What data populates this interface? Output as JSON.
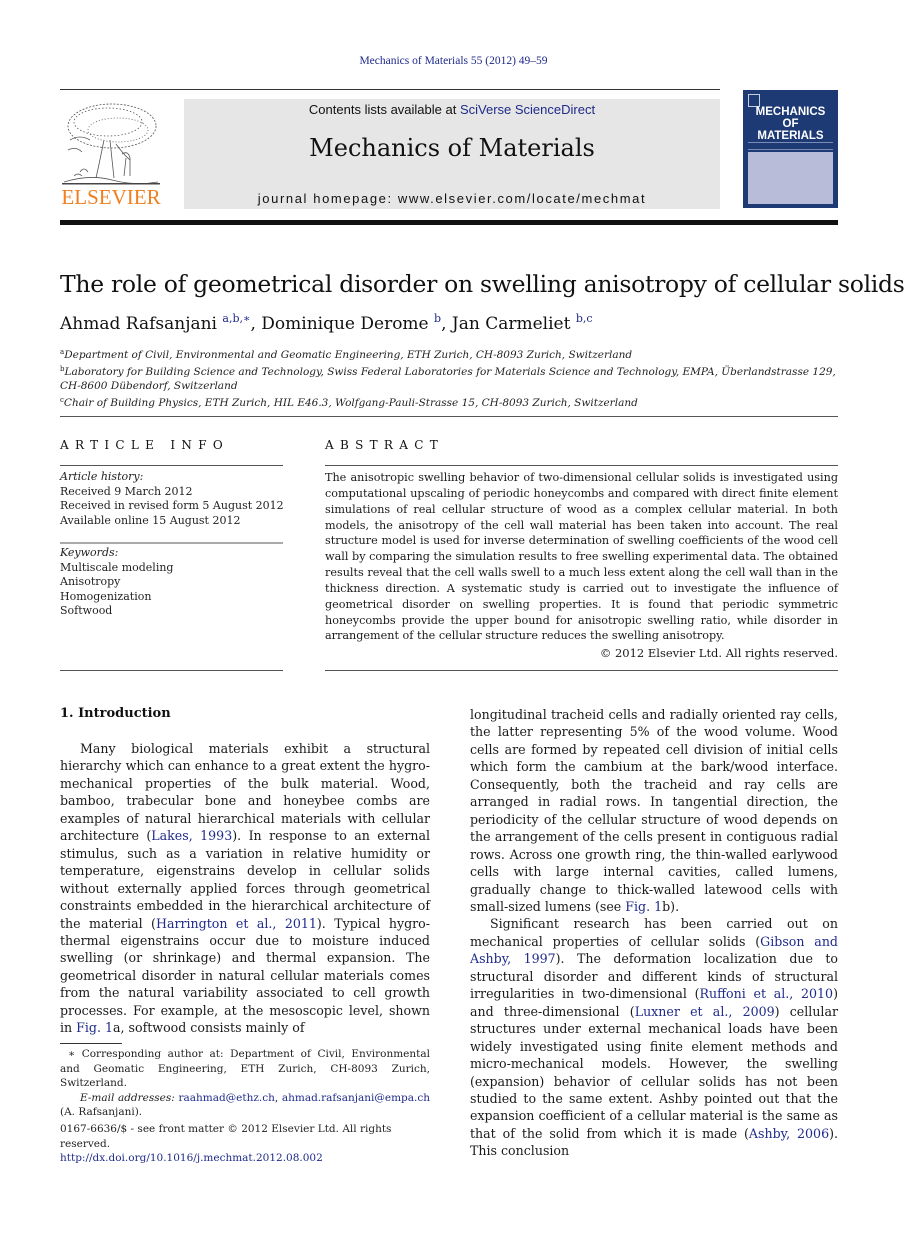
{
  "header": {
    "journal_reference": "Mechanics of Materials 55 (2012) 49–59",
    "publisher_logo_text": "ELSEVIER",
    "contents_prefix": "Contents lists available at ",
    "contents_link": "SciVerse ScienceDirect",
    "journal_title": "Mechanics of Materials",
    "homepage": "journal homepage: www.elsevier.com/locate/mechmat",
    "cover": {
      "title_line1": "MECHANICS",
      "title_line2": "OF",
      "title_line3": "MATERIALS",
      "color": "#1d3a75"
    }
  },
  "article": {
    "title": "The role of geometrical disorder on swelling anisotropy of cellular solids",
    "authors": [
      {
        "name": "Ahmad Rafsanjani",
        "sup": "a,b,∗",
        "sep": ", "
      },
      {
        "name": "Dominique Derome",
        "sup": "b",
        "sep": ", "
      },
      {
        "name": "Jan Carmeliet",
        "sup": "b,c",
        "sep": ""
      }
    ],
    "affiliations": [
      {
        "mark": "a",
        "text": "Department of Civil, Environmental and Geomatic Engineering, ETH Zurich, CH-8093 Zurich, Switzerland"
      },
      {
        "mark": "b",
        "text": "Laboratory for Building Science and Technology, Swiss Federal Laboratories for Materials Science and Technology, EMPA, Überlandstrasse 129, CH-8600 Dübendorf, Switzerland"
      },
      {
        "mark": "c",
        "text": "Chair of Building Physics, ETH Zurich, HIL E46.3, Wolfgang-Pauli-Strasse 15, CH-8093 Zurich, Switzerland"
      }
    ]
  },
  "article_info": {
    "heading": "ARTICLE INFO",
    "history_label": "Article history:",
    "history": [
      "Received 9 March 2012",
      "Received in revised form 5 August 2012",
      "Available online 15 August 2012"
    ],
    "keywords_label": "Keywords:",
    "keywords": [
      "Multiscale modeling",
      "Anisotropy",
      "Homogenization",
      "Softwood"
    ]
  },
  "abstract": {
    "heading": "ABSTRACT",
    "text": "The anisotropic swelling behavior of two-dimensional cellular solids is investigated using computational upscaling of periodic honeycombs and compared with direct finite element simulations of real cellular structure of wood as a complex cellular material. In both models, the anisotropy of the cell wall material has been taken into account. The real structure model is used for inverse determination of swelling coefficients of the wood cell wall by comparing the simulation results to free swelling experimental data. The obtained results reveal that the cell walls swell to a much less extent along the cell wall than in the thickness direction. A systematic study is carried out to investigate the influence of geometrical disorder on swelling properties. It is found that periodic symmetric honeycombs provide the upper bound for anisotropic swelling ratio, while disorder in arrangement of the cellular structure reduces the swelling anisotropy.",
    "copyright": "© 2012 Elsevier Ltd. All rights reserved."
  },
  "introduction": {
    "heading": "1. Introduction",
    "p1": [
      {
        "t": "Many biological materials exhibit a structural hierarchy which can enhance to a great extent the hygro-mechanical properties of the bulk material. Wood, bamboo, trabecular bone and honeybee combs are examples of natural hierarchical materials with cellular architecture ("
      },
      {
        "link": "Lakes, 1993"
      },
      {
        "t": "). In response to an external stimulus, such as a variation in relative humidity or temperature, eigenstrains develop in cellular solids without externally applied forces through geometrical constraints embedded in the hierarchical architecture of the material ("
      },
      {
        "link": "Harrington et al., 2011"
      },
      {
        "t": "). Typical hygro-thermal eigenstrains occur due to moisture induced swelling (or shrinkage) and thermal expansion. The geometrical disorder in natural cellular materials comes from the natural variability associated to cell growth processes. For example, at the mesoscopic level, shown in "
      },
      {
        "link": "Fig. 1"
      },
      {
        "t": "a, softwood consists mainly of longitudinal tracheid cells and radially oriented ray cells, the latter representing 5% of the wood volume. Wood cells are formed by repeated cell division of initial cells which form the cambium at the bark/wood interface. Consequently, both the tracheid and ray cells are arranged in radial rows. In tangential direction, the periodicity of the cellular structure of wood depends on the arrangement of the cells present in contiguous radial rows. Across one growth ring, the thin-walled earlywood cells with large internal cavities, called lumens, gradually change to thick-walled latewood cells with small-sized lumens (see "
      },
      {
        "link": "Fig. 1"
      },
      {
        "t": "b)."
      }
    ],
    "left_col_text_a": "Many biological materials exhibit a structural hierarchy which can enhance to a great extent the hygro-mechanical properties of the bulk material. Wood, bamboo, trabecular bone and honeybee combs are examples of natural hierarchical materials with cellular architecture (",
    "link_lakes": "Lakes, 1993",
    "left_col_text_b": "). In response to an external stimulus, such as a variation in relative humidity or temperature, eigenstrains develop in cellular solids without externally applied forces through geometrical constraints embedded in the hierarchical architecture of the material (",
    "link_harrington": "Harrington et al., 2011",
    "left_col_text_c": "). Typical hygro-thermal eigenstrains occur due to moisture induced swelling (or shrinkage) and thermal expansion. The geometrical disorder in natural cellular materials comes from the natural variability associated to cell growth processes. For example, at the mesoscopic level, shown in ",
    "link_fig1": "Fig. 1",
    "left_col_text_d": "a, softwood consists mainly of",
    "right_col_text_a": "longitudinal tracheid cells and radially oriented ray cells, the latter representing 5% of the wood volume. Wood cells are formed by repeated cell division of initial cells which form the cambium at the bark/wood interface. Consequently, both the tracheid and ray cells are arranged in radial rows. In tangential direction, the periodicity of the cellular structure of wood depends on the arrangement of the cells present in contiguous radial rows. Across one growth ring, the thin-walled earlywood cells with large internal cavities, called lumens, gradually change to thick-walled latewood cells with small-sized lumens (see ",
    "link_fig1b": "Fig. 1",
    "right_col_text_b": "b).",
    "p2_a": "Significant research has been carried out on mechanical properties of cellular solids (",
    "link_gibson": "Gibson and Ashby, 1997",
    "p2_b": "). The deformation localization due to structural disorder and different kinds of structural irregularities in two-dimensional (",
    "link_ruffoni": "Ruffoni et al., 2010",
    "p2_c": ") and three-dimensional (",
    "link_luxner": "Luxner et al., 2009",
    "p2_d": ") cellular structures under external mechanical loads have been widely investigated using finite element methods and micro-mechanical models. However, the swelling (expansion) behavior of cellular solids has not been studied to the same extent. Ashby pointed out that the expansion coefficient of a cellular material is the same as that of the solid from which it is made (",
    "link_ashby": "Ashby, 2006",
    "p2_e": "). This conclusion"
  },
  "footnotes": {
    "corresponding": "∗ Corresponding author at: Department of Civil, Environmental and Geomatic Engineering, ETH Zurich, CH-8093 Zurich, Switzerland.",
    "email_label": "E-mail addresses:",
    "email1": "raahmad@ethz.ch",
    "email_sep": ", ",
    "email2": "ahmad.rafsanjani@empa.ch",
    "email_owner": "(A. Rafsanjani).",
    "front_matter": "0167-6636/$ - see front matter © 2012 Elsevier Ltd. All rights reserved.",
    "doi": "http://dx.doi.org/10.1016/j.mechmat.2012.08.002"
  },
  "colors": {
    "link": "#1f2a8a",
    "elsevier_orange": "#f07f1f",
    "banner_bg": "#e6e6e6"
  }
}
